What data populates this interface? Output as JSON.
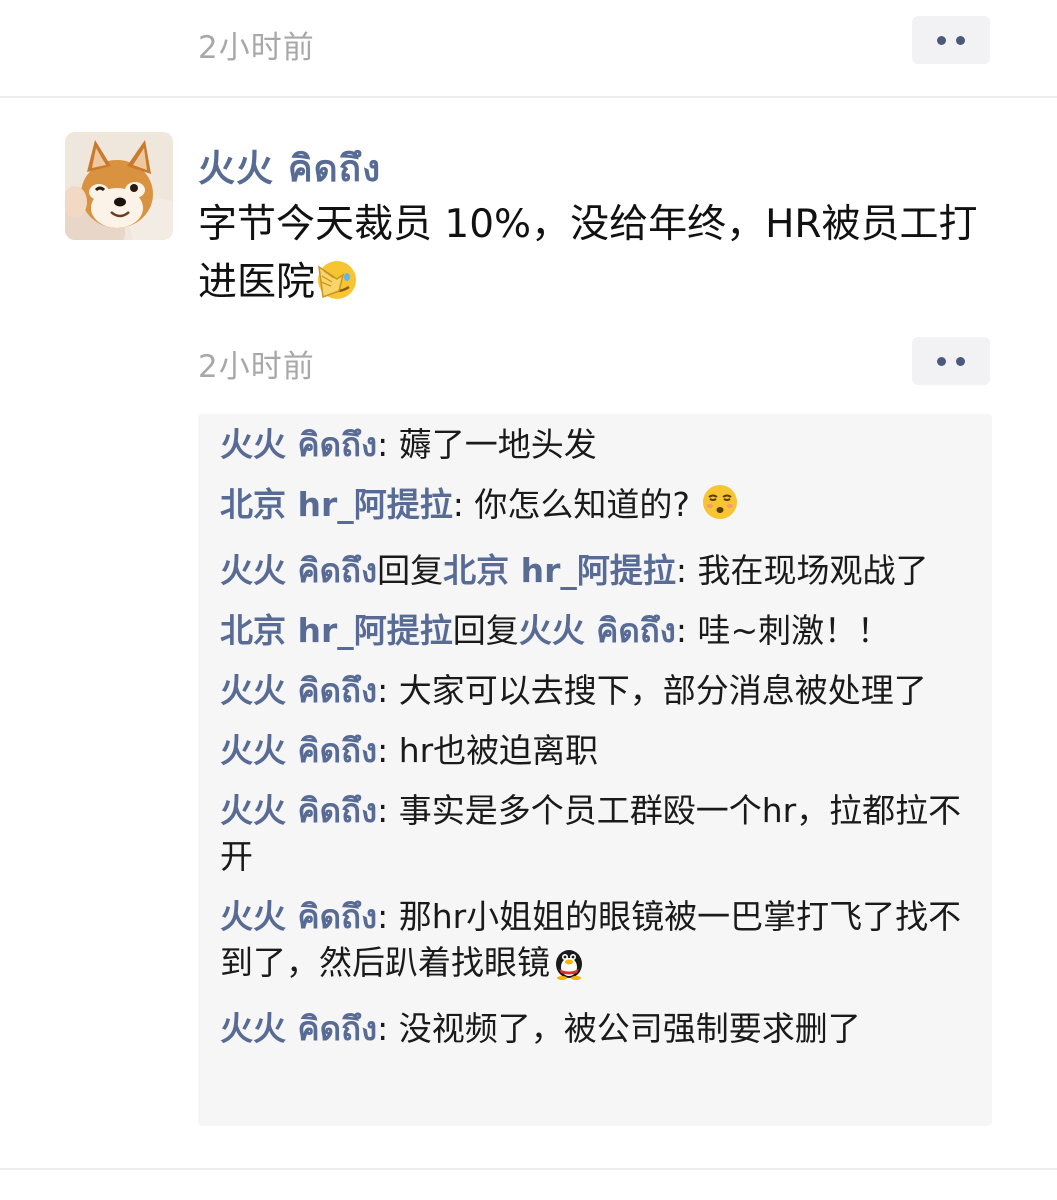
{
  "top_item": {
    "time": "2小时前",
    "more_icon": "more-dots-icon"
  },
  "post": {
    "avatar_icon": "shiba-dog-avatar",
    "author": "火火 คิดถึง",
    "text": "字节今天裁员 10%，没给年终，HR被员工打进医院",
    "text_emoji": "facepalm-emoji",
    "time": "2小时前",
    "more_icon": "more-dots-icon"
  },
  "comments": [
    {
      "name": "火火 คิดถึง",
      "reply_word": "",
      "reply_to": "",
      "text": ": 薅了一地头发",
      "emoji": ""
    },
    {
      "name": "北京 hr_阿提拉",
      "reply_word": "",
      "reply_to": "",
      "text": ": 你怎么知道的?",
      "emoji": "smirk-emoji"
    },
    {
      "name": "火火 คิดถึง",
      "reply_word": "回复",
      "reply_to": "北京 hr_阿提拉",
      "text": ": 我在现场观战了",
      "emoji": ""
    },
    {
      "name": "北京 hr_阿提拉",
      "reply_word": "回复",
      "reply_to": "火火 คิดถึง",
      "text": ": 哇~刺激！！",
      "emoji": ""
    },
    {
      "name": "火火 คิดถึง",
      "reply_word": "",
      "reply_to": "",
      "text": ": 大家可以去搜下，部分消息被处理了",
      "emoji": ""
    },
    {
      "name": "火火 คิดถึง",
      "reply_word": "",
      "reply_to": "",
      "text": ": hr也被迫离职",
      "emoji": ""
    },
    {
      "name": "火火 คิดถึง",
      "reply_word": "",
      "reply_to": "",
      "text": ": 事实是多个员工群殴一个hr，拉都拉不开",
      "emoji": ""
    },
    {
      "name": "火火 คิดถึง",
      "reply_word": "",
      "reply_to": "",
      "text": ": 那hr小姐姐的眼镜被一巴掌打飞了找不到了，然后趴着找眼镜",
      "emoji": "qq-penguin-emoji"
    },
    {
      "name": "火火 คิดถึง",
      "reply_word": "",
      "reply_to": "",
      "text": ": 没视频了，被公司强制要求删了",
      "emoji": ""
    }
  ]
}
